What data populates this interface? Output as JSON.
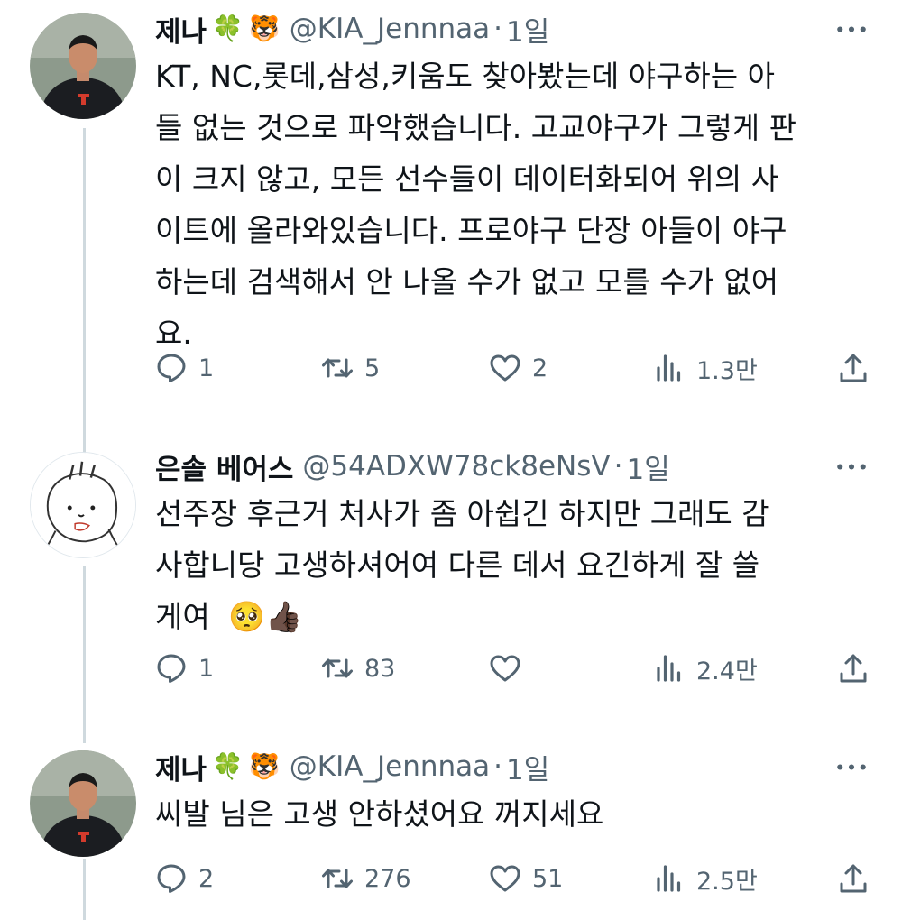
{
  "tweets": [
    {
      "name": "제나",
      "emoji1": "🍀",
      "emoji2": "🐯",
      "handle": "@KIA_Jennnaa",
      "separator": "·",
      "time": "1일",
      "lines": [
        "KT, NC,롯데,삼성,키움도 찾아봤는데 야구하는 아",
        "들 없는 것으로 파악했습니다. 고교야구가 그렇게 판",
        "이 크지 않고, 모든 선수들이 데이터화되어 위의 사",
        "이트에 올라와있습니다. 프로야구 단장 아들이 야구",
        "하는데 검색해서 안 나올 수가 없고 모를 수가 없어",
        "요."
      ],
      "replies": "1",
      "retweets": "5",
      "likes": "2",
      "views": "1.3만"
    },
    {
      "name": "은솔 베어스",
      "handle": "@54ADXW78ck8eNsV",
      "separator": "·",
      "time": "1일",
      "lines": [
        "선주장 후근거 처사가 좀 아쉽긴 하지만 그래도 감",
        "사합니당 고생하셔어여 다른 데서 요긴하게 잘 쓸",
        "게여"
      ],
      "line_emojis": "🥺👍🏿",
      "replies": "1",
      "retweets": "83",
      "likes": "",
      "views": "2.4만"
    },
    {
      "name": "제나",
      "emoji1": "🍀",
      "emoji2": "🐯",
      "handle": "@KIA_Jennnaa",
      "separator": "·",
      "time": "1일",
      "lines": [
        "씨발 님은 고생 안하셨어요 꺼지세요"
      ],
      "replies": "2",
      "retweets": "276",
      "likes": "51",
      "views": "2.5만"
    }
  ],
  "icons": [
    "reply-icon",
    "retweet-icon",
    "like-icon",
    "views-icon",
    "share-icon",
    "more-icon"
  ],
  "colors": {
    "text": "#0f1419",
    "secondary": "#536471",
    "thread_line": "#cfd9de"
  }
}
